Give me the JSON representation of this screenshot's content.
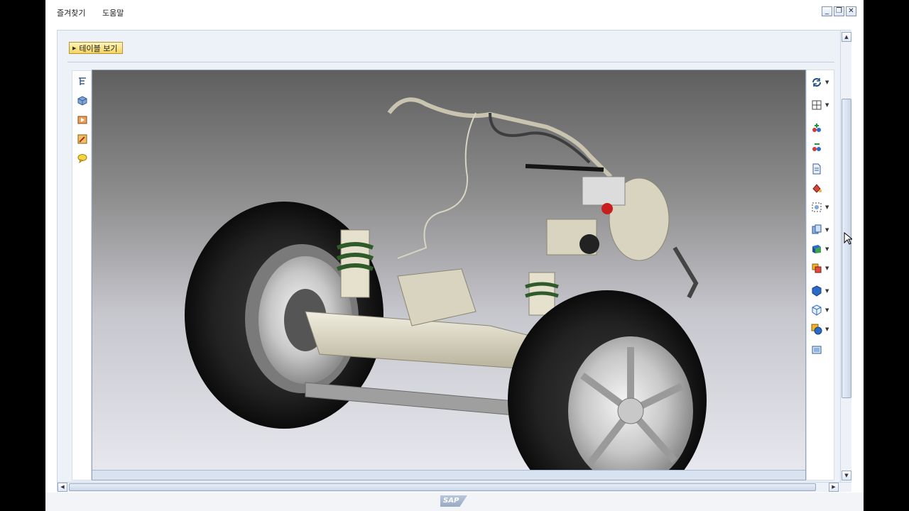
{
  "menu": {
    "favorites": "즐겨찾기",
    "help": "도움말"
  },
  "window_controls": {
    "minimize": "_",
    "restore": "❐",
    "close": "✕"
  },
  "toolbar": {
    "table_view_label": "테이블 보기"
  },
  "left_tools": [
    "structure-tree-icon",
    "cube-icon",
    "media-icon",
    "edit-icon",
    "comment-icon"
  ],
  "right_tools": [
    "rotate-icon",
    "view-layout-icon",
    "add-markup-icon",
    "remove-markup-icon",
    "document-icon",
    "paint-icon",
    "fit-selection-icon",
    "copy-icon",
    "cutaway-icon",
    "crosssection-icon",
    "shaded-icon",
    "wireframe-icon",
    "shape-icon",
    "fullscreen-icon"
  ],
  "footer": {
    "logo_text": "SAP"
  },
  "colors": {
    "accent": "#2f6db5",
    "button_bg": "#f4d560",
    "panel_bg": "#edf2f9"
  }
}
